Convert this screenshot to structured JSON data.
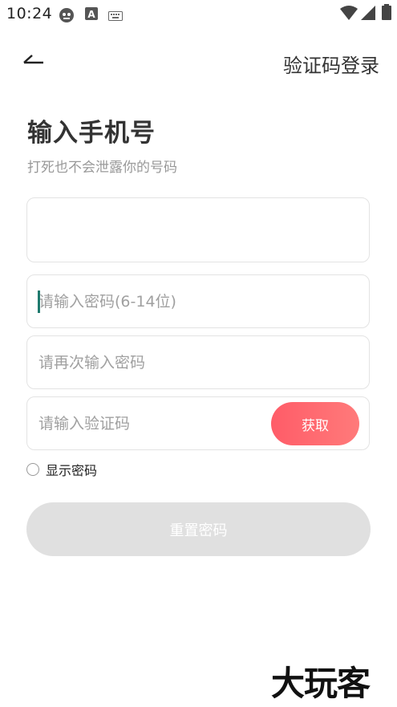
{
  "status_bar": {
    "time": "10:24",
    "icons": [
      "face-icon",
      "a-notification-icon",
      "keyboard-icon",
      "wifi-icon",
      "signal-icon",
      "battery-icon"
    ]
  },
  "header": {
    "back_icon": "back-arrow-icon",
    "switch_login_label": "验证码登录"
  },
  "main": {
    "title": "输入手机号",
    "subtitle": "打死也不会泄露你的号码",
    "phone_input": {
      "value": "",
      "placeholder": ""
    },
    "password_input": {
      "value": "",
      "placeholder": "请输入密码(6-14位)"
    },
    "confirm_password_input": {
      "value": "",
      "placeholder": "请再次输入密码"
    },
    "code_input": {
      "value": "",
      "placeholder": "请输入验证码"
    },
    "get_code_label": "获取",
    "show_password_label": "显示密码",
    "reset_button_label": "重置密码"
  },
  "watermark": "大玩客",
  "colors": {
    "accent_start": "#ff5c68",
    "accent_end": "#ff7a7a",
    "disabled_button": "#e0e0e0",
    "cursor": "#1f7a6e"
  }
}
